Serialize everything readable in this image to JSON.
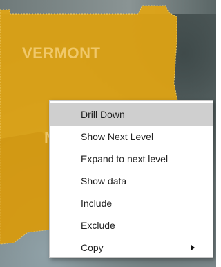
{
  "map": {
    "state_label": "VERMONT",
    "partial_label": "N",
    "colors": {
      "state_fill": "#e2a512",
      "label": "#f0c86a",
      "terrain": "#6a7676"
    }
  },
  "context_menu": {
    "items": [
      {
        "label": "Drill Down",
        "highlighted": true,
        "has_submenu": false
      },
      {
        "label": "Show Next Level",
        "highlighted": false,
        "has_submenu": false
      },
      {
        "label": "Expand to next level",
        "highlighted": false,
        "has_submenu": false
      },
      {
        "label": "Show data",
        "highlighted": false,
        "has_submenu": false
      },
      {
        "label": "Include",
        "highlighted": false,
        "has_submenu": false
      },
      {
        "label": "Exclude",
        "highlighted": false,
        "has_submenu": false
      },
      {
        "label": "Copy",
        "highlighted": false,
        "has_submenu": true,
        "submenu_icon": "chevron-right-icon"
      }
    ],
    "highlight_color": "#cfcfcf"
  }
}
